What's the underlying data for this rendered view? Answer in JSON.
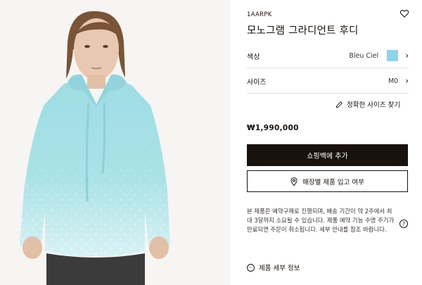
{
  "product": {
    "sku": "1AARPK",
    "name": "모노그램 그라디언트 후디",
    "color_label": "색상",
    "color_value": "Bleu Ciel",
    "color_swatch": "#8fd3ea",
    "size_label": "사이즈",
    "size_value": "M0",
    "size_guide": "정확한 사이즈 찾기",
    "price": "₩1,990,000"
  },
  "actions": {
    "add_to_cart": "쇼핑백에 추가",
    "store_stock": "매장별 제품 입고 여부"
  },
  "note": "본 제품은 예약구매로 진행되며, 배송 기간이 약 2주에서 최대 3달까지 소요될 수 있습니다. 제품 예약 기능 수명 주기가 만료되면 주문이 취소됩니다. 세부 안내를 참조 바랍니다.",
  "details_link": "제품 세부 정보",
  "icons": {
    "wishlist": "heart-icon",
    "chevron": "chevron-right-icon",
    "size_guide": "ruler-pencil-icon",
    "stock": "location-pin-icon",
    "help": "question-circle-icon",
    "details": "more-dots-icon"
  },
  "colors": {
    "primary": "#19110b",
    "hoodie": "#a7e0e6",
    "background_image": "#f6f5f3"
  }
}
